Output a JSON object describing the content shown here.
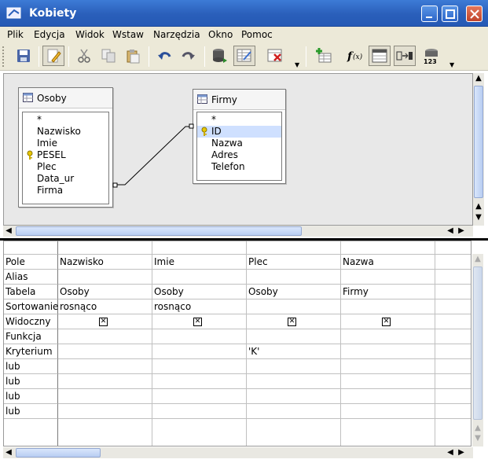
{
  "window": {
    "title": "Kobiety"
  },
  "menu": [
    {
      "label": "Plik"
    },
    {
      "label": "Edycja"
    },
    {
      "label": "Widok"
    },
    {
      "label": "Wstaw"
    },
    {
      "label": "Narzędzia"
    },
    {
      "label": "Okno"
    },
    {
      "label": "Pomoc"
    }
  ],
  "toolbar": [
    "save-icon",
    "edit-icon",
    "cut-icon",
    "copy-icon",
    "paste-icon",
    "undo-icon",
    "redo-icon",
    "run-query-icon",
    "clear-query-icon",
    "delete-icon",
    "add-table-icon",
    "functions-icon",
    "table-name-icon",
    "alias-icon",
    "distinct-values-icon"
  ],
  "tables": [
    {
      "name": "Osoby",
      "fields": [
        "*",
        "Nazwisko",
        "Imie",
        "PESEL",
        "Plec",
        "Data_ur",
        "Firma"
      ],
      "key_field": "PESEL"
    },
    {
      "name": "Firmy",
      "fields": [
        "*",
        "ID",
        "Nazwa",
        "Adres",
        "Telefon"
      ],
      "key_field": "ID",
      "selected_field": "ID"
    }
  ],
  "grid": {
    "row_labels": [
      "Pole",
      "Alias",
      "Tabela",
      "Sortowanie",
      "Widoczny",
      "Funkcja",
      "Kryterium",
      "lub",
      "lub",
      "lub",
      "lub"
    ],
    "columns": [
      {
        "pole": "Nazwisko",
        "alias": "",
        "tabela": "Osoby",
        "sortowanie": "rosnąco",
        "widoczny": true,
        "funkcja": "",
        "kryterium": ""
      },
      {
        "pole": "Imie",
        "alias": "",
        "tabela": "Osoby",
        "sortowanie": "rosnąco",
        "widoczny": true,
        "funkcja": "",
        "kryterium": ""
      },
      {
        "pole": "Plec",
        "alias": "",
        "tabela": "Osoby",
        "sortowanie": "",
        "widoczny": true,
        "funkcja": "",
        "kryterium": "'K'"
      },
      {
        "pole": "Nazwa",
        "alias": "",
        "tabela": "Firmy",
        "sortowanie": "",
        "widoczny": true,
        "funkcja": "",
        "kryterium": ""
      }
    ],
    "checkbox_mark": "☒"
  },
  "colors": {
    "titlebar": "#2a5fba",
    "selection": "#cfe0ff",
    "key_icon": "#d8b800"
  }
}
